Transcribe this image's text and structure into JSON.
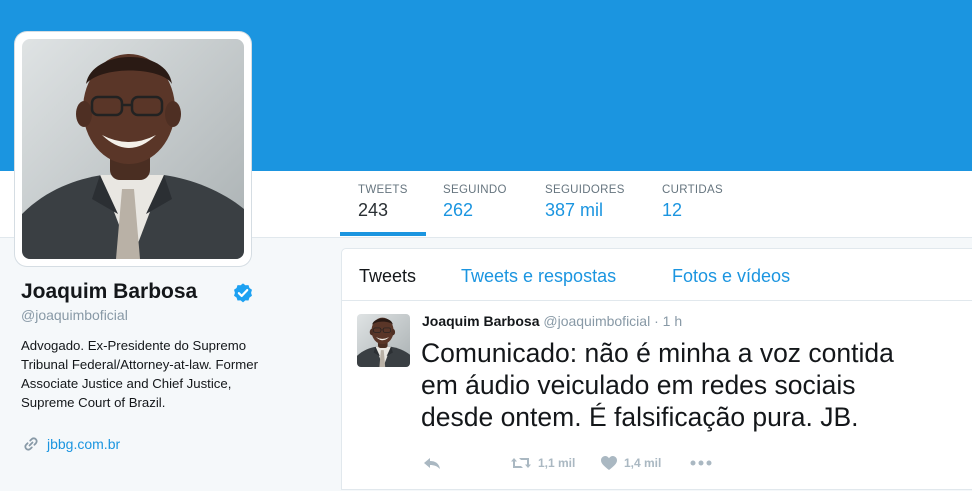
{
  "profile": {
    "name": "Joaquim Barbosa",
    "handle": "@joaquimboficial",
    "bio_lines": [
      "Advogado. Ex-Presidente do Supremo",
      "Tribunal Federal/Attorney-at-law. Former",
      "Associate Justice and Chief Justice,",
      "Supreme Court of Brazil."
    ],
    "website": "jbbg.com.br"
  },
  "stats": [
    {
      "label": "TWEETS",
      "value": "243"
    },
    {
      "label": "SEGUINDO",
      "value": "262"
    },
    {
      "label": "SEGUIDORES",
      "value": "387 mil"
    },
    {
      "label": "CURTIDAS",
      "value": "12"
    }
  ],
  "tabs": [
    {
      "label": "Tweets"
    },
    {
      "label": "Tweets e respostas"
    },
    {
      "label": "Fotos e vídeos"
    }
  ],
  "tweet": {
    "author": "Joaquim Barbosa",
    "handle": "@joaquimboficial",
    "separator": "·",
    "time": "1 h",
    "text_lines": [
      "Comunicado: não é minha a voz contida",
      "em áudio veiculado em redes sociais",
      "desde ontem. É falsificação pura. JB."
    ],
    "retweets": "1,1 mil",
    "likes": "1,4 mil"
  },
  "colors": {
    "banner": "#1b95e0",
    "accent": "#1b95e0",
    "background": "#f5f8fa",
    "retweet_icon": "#19cf86",
    "like_icon": "#aab8c2"
  },
  "icons": [
    "verified-badge-icon",
    "link-icon",
    "reply-icon",
    "retweet-icon",
    "heart-icon",
    "more-icon"
  ]
}
